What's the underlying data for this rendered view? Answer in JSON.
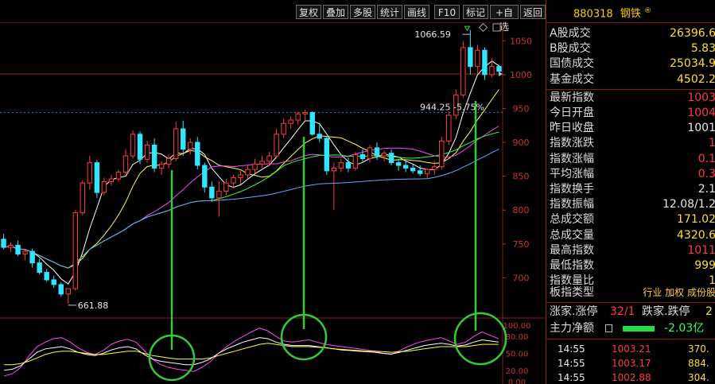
{
  "toolbar": {
    "buttons": [
      "复权",
      "叠加",
      "多股",
      "统计",
      "画线",
      "F10",
      "标记",
      "+自选",
      "返回"
    ]
  },
  "stock": {
    "code": "880318",
    "name": "钢铁",
    "badge": "®"
  },
  "quote_rows": [
    {
      "label": "A股成交",
      "value": "26396.6",
      "color": "yellow"
    },
    {
      "label": "B股成交",
      "value": "5.83",
      "color": "yellow"
    },
    {
      "label": "国债成交",
      "value": "25034.9",
      "color": "yellow"
    },
    {
      "label": "基金成交",
      "value": "4502.2",
      "color": "yellow"
    },
    {
      "label": "最新指数",
      "value": "1003",
      "color": "red"
    },
    {
      "label": "今日开盘",
      "value": "1004",
      "color": "red"
    },
    {
      "label": "昨日收盘",
      "value": "1001",
      "color": "white"
    },
    {
      "label": "指数涨跌",
      "value": "1",
      "color": "red"
    },
    {
      "label": "指数涨幅",
      "value": "0.1",
      "color": "red"
    },
    {
      "label": "平均涨幅",
      "value": "0.3",
      "color": "red"
    },
    {
      "label": "指数换手",
      "value": "2.1",
      "color": "white"
    },
    {
      "label": "指数振幅",
      "value": "12.08/1.2",
      "color": "white"
    },
    {
      "label": "总成交额",
      "value": "171.02",
      "color": "yellow"
    },
    {
      "label": "总成交量",
      "value": "4320.6",
      "color": "yellow"
    },
    {
      "label": "最高指数",
      "value": "1011",
      "color": "red"
    },
    {
      "label": "最低指数",
      "value": "999",
      "color": "yellow"
    },
    {
      "label": "指数量比",
      "value": "1",
      "color": "yellow"
    }
  ],
  "board_type": {
    "label": "板指类型",
    "options": "行业 加权 成份股"
  },
  "limit_stats": {
    "up_label": "涨家.涨停",
    "up_value": "32/1",
    "down_label": "跌家.跌停",
    "down_value": "2"
  },
  "main_flow": {
    "label": "主力净额",
    "value": "-2.03亿"
  },
  "ticks": [
    {
      "time": "14:55",
      "price": "1003.21",
      "vol": "370."
    },
    {
      "time": "14:55",
      "price": "1003.17",
      "vol": "884."
    },
    {
      "time": "14:55",
      "price": "1002.88",
      "vol": "304."
    }
  ],
  "colors": {
    "up": "#ff3c3c",
    "down": "#30e6ff",
    "ma1": "#ffffff",
    "ma2": "#ffff33",
    "ma3": "#ff44ff",
    "ma4": "#33ff33",
    "ma5": "#66aaff",
    "annotation": "#33cc33",
    "accent": "#8a1a1a"
  },
  "chart_data": {
    "type": "candlestick",
    "y_axis": {
      "min": 650,
      "max": 1075,
      "ticks": [
        700,
        750,
        800,
        850,
        900,
        950,
        1000,
        1050
      ]
    },
    "annotations": {
      "high_label": "1066.59",
      "high_value": 1066.59,
      "low_label": "661.88",
      "low_value": 661.88,
      "level_label": "944.25 -5.75%",
      "level_value": 944.25,
      "prev_close": 1001
    },
    "candles": [
      [
        757,
        765,
        742,
        745
      ],
      [
        745,
        752,
        738,
        748
      ],
      [
        748,
        755,
        732,
        735
      ],
      [
        735,
        742,
        726,
        739
      ],
      [
        739,
        743,
        715,
        722
      ],
      [
        722,
        728,
        705,
        708
      ],
      [
        708,
        713,
        694,
        697
      ],
      [
        697,
        703,
        685,
        690
      ],
      [
        690,
        693,
        672,
        676
      ],
      [
        676,
        682,
        662,
        684
      ],
      [
        684,
        800,
        681,
        796
      ],
      [
        796,
        844,
        792,
        840
      ],
      [
        840,
        880,
        830,
        870
      ],
      [
        870,
        874,
        818,
        826
      ],
      [
        826,
        848,
        822,
        842
      ],
      [
        842,
        852,
        836,
        846
      ],
      [
        846,
        860,
        842,
        856
      ],
      [
        856,
        890,
        852,
        880
      ],
      [
        880,
        918,
        876,
        912
      ],
      [
        912,
        916,
        868,
        875
      ],
      [
        875,
        902,
        870,
        896
      ],
      [
        896,
        906,
        856,
        862
      ],
      [
        862,
        872,
        852,
        868
      ],
      [
        868,
        882,
        862,
        876
      ],
      [
        876,
        930,
        872,
        920
      ],
      [
        920,
        932,
        880,
        890
      ],
      [
        890,
        906,
        882,
        900
      ],
      [
        900,
        908,
        860,
        866
      ],
      [
        866,
        870,
        826,
        834
      ],
      [
        834,
        842,
        812,
        818
      ],
      [
        818,
        842,
        790,
        828
      ],
      [
        828,
        846,
        822,
        840
      ],
      [
        840,
        852,
        832,
        848
      ],
      [
        848,
        858,
        838,
        852
      ],
      [
        852,
        866,
        846,
        860
      ],
      [
        860,
        876,
        854,
        868
      ],
      [
        868,
        880,
        862,
        872
      ],
      [
        872,
        886,
        866,
        880
      ],
      [
        880,
        920,
        876,
        912
      ],
      [
        912,
        935,
        906,
        928
      ],
      [
        928,
        938,
        920,
        933
      ],
      [
        933,
        945,
        926,
        942
      ],
      [
        942,
        948,
        932,
        944
      ],
      [
        944,
        946,
        910,
        912
      ],
      [
        912,
        926,
        900,
        906
      ],
      [
        906,
        908,
        852,
        858
      ],
      [
        858,
        870,
        800,
        862
      ],
      [
        862,
        876,
        856,
        870
      ],
      [
        870,
        878,
        856,
        862
      ],
      [
        862,
        886,
        858,
        882
      ],
      [
        882,
        890,
        870,
        876
      ],
      [
        876,
        896,
        870,
        892
      ],
      [
        892,
        900,
        874,
        880
      ],
      [
        880,
        888,
        872,
        884
      ],
      [
        884,
        890,
        866,
        870
      ],
      [
        870,
        876,
        858,
        866
      ],
      [
        866,
        872,
        856,
        862
      ],
      [
        862,
        868,
        854,
        858
      ],
      [
        858,
        866,
        850,
        854
      ],
      [
        854,
        862,
        846,
        860
      ],
      [
        860,
        872,
        852,
        864
      ],
      [
        864,
        908,
        860,
        902
      ],
      [
        902,
        946,
        896,
        940
      ],
      [
        940,
        978,
        934,
        970
      ],
      [
        970,
        1050,
        966,
        1040
      ],
      [
        1040,
        1066,
        1000,
        1012
      ],
      [
        1012,
        1044,
        1002,
        1036
      ],
      [
        1036,
        1040,
        992,
        1000
      ],
      [
        1000,
        1024,
        996,
        1012
      ],
      [
        1012,
        1014,
        1000,
        1005
      ]
    ],
    "ma_series": [
      {
        "color_key": "ma1",
        "period": 5
      },
      {
        "color_key": "ma2",
        "period": 10
      },
      {
        "color_key": "ma3",
        "period": 20
      },
      {
        "color_key": "ma4",
        "period": 30
      },
      {
        "color_key": "ma5",
        "period": 60
      }
    ],
    "indicator": {
      "y_axis": {
        "ticks": [
          "100.00",
          "80.00",
          "50.00",
          "20.00",
          "0.00"
        ],
        "min": 0,
        "max": 100
      },
      "series": [
        {
          "color_key": "ma3",
          "values": [
            10,
            14,
            25,
            45,
            62,
            70,
            76,
            78,
            70,
            60,
            52,
            48,
            55,
            66,
            72,
            75,
            70,
            55,
            40,
            30,
            25,
            22,
            20,
            18,
            25,
            35,
            50,
            62,
            72,
            80,
            88,
            95,
            90,
            80,
            72,
            70,
            72,
            74,
            70,
            66,
            64,
            62,
            60,
            58,
            56,
            54,
            50,
            48,
            55,
            62,
            68,
            72,
            75,
            78,
            72,
            66,
            70,
            80,
            88,
            82,
            76
          ]
        },
        {
          "color_key": "ma1",
          "values": [
            20,
            22,
            28,
            40,
            52,
            58,
            60,
            62,
            58,
            52,
            48,
            46,
            50,
            56,
            60,
            62,
            58,
            48,
            40,
            36,
            34,
            32,
            30,
            30,
            34,
            40,
            50,
            58,
            64,
            70,
            74,
            78,
            76,
            70,
            66,
            64,
            64,
            64,
            62,
            60,
            58,
            56,
            55,
            54,
            53,
            52,
            50,
            49,
            52,
            56,
            60,
            64,
            66,
            68,
            66,
            63,
            65,
            70,
            74,
            72,
            70
          ]
        },
        {
          "color_key": "ma2",
          "values": [
            30,
            30,
            32,
            36,
            42,
            48,
            52,
            54,
            54,
            52,
            50,
            48,
            48,
            50,
            52,
            54,
            54,
            50,
            46,
            44,
            42,
            40,
            40,
            40,
            40,
            42,
            46,
            50,
            54,
            58,
            62,
            66,
            68,
            66,
            64,
            62,
            62,
            62,
            61,
            60,
            58,
            57,
            56,
            55,
            54,
            54,
            53,
            52,
            53,
            54,
            56,
            58,
            60,
            62,
            62,
            62,
            62,
            64,
            66,
            66,
            66
          ]
        }
      ]
    }
  }
}
